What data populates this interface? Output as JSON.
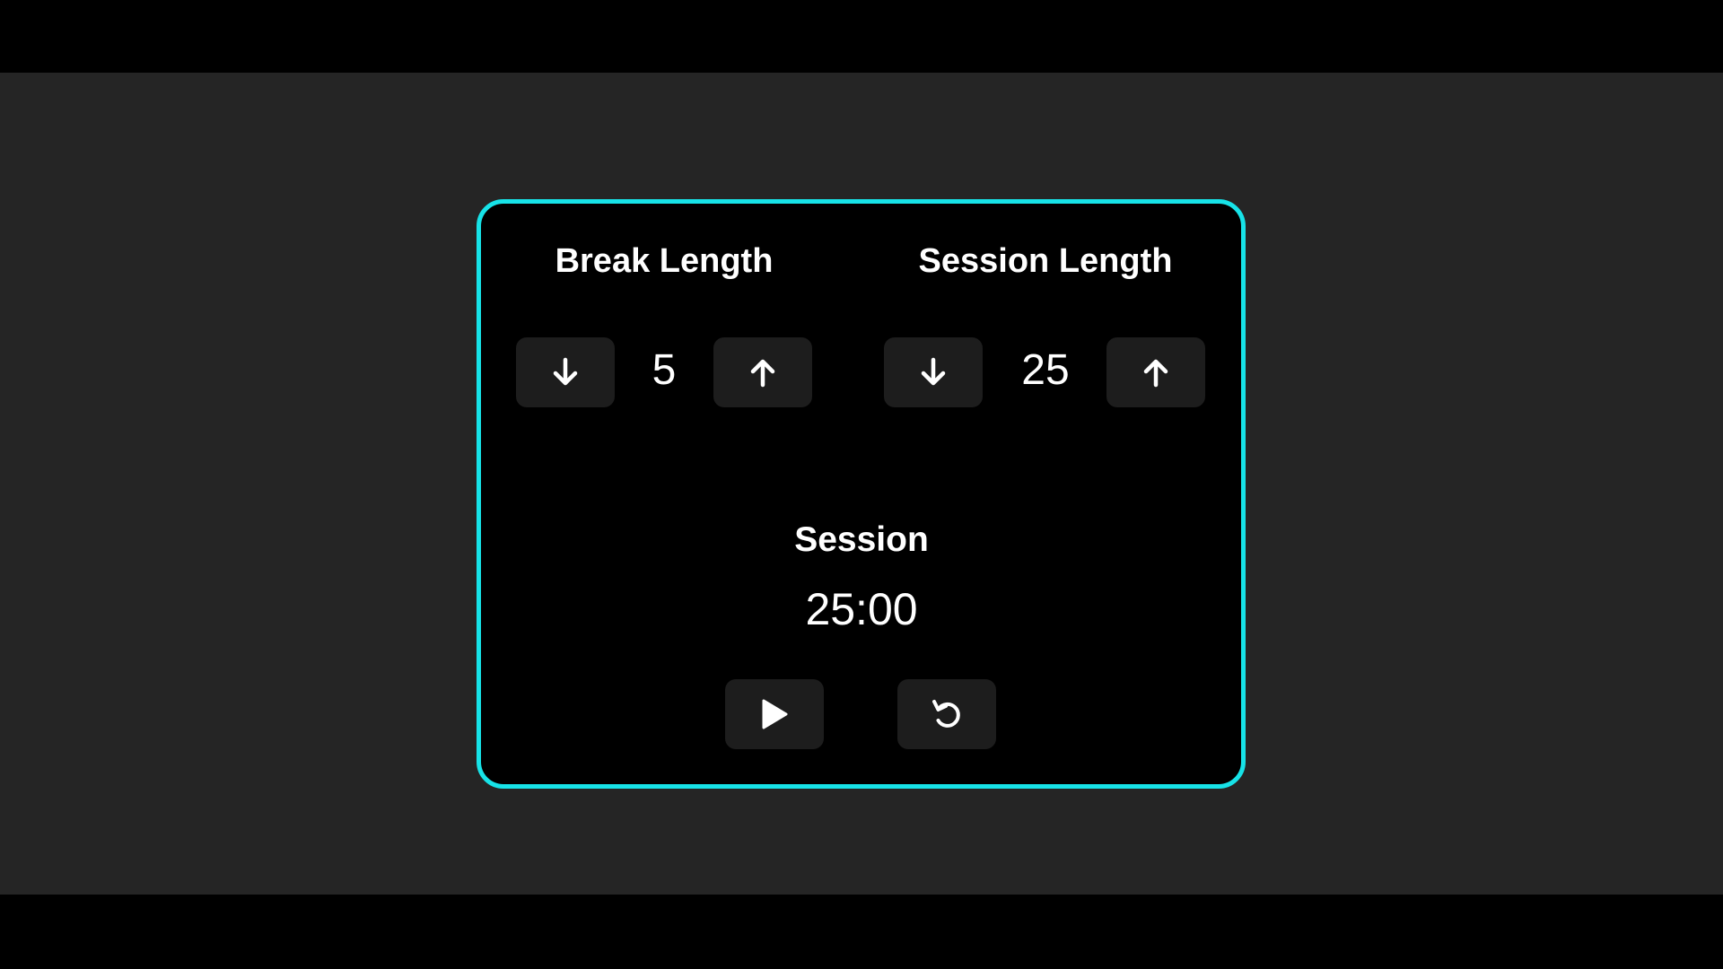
{
  "break": {
    "label": "Break Length",
    "value": "5",
    "decrement_icon": "arrow-down-icon",
    "increment_icon": "arrow-up-icon"
  },
  "session": {
    "label": "Session Length",
    "value": "25",
    "decrement_icon": "arrow-down-icon",
    "increment_icon": "arrow-up-icon"
  },
  "timer": {
    "label": "Session",
    "time_left": "25:00",
    "start_stop_icon": "play-icon",
    "reset_icon": "reset-icon"
  },
  "colors": {
    "accent_border": "#17e3e8",
    "page_background": "#252525",
    "card_background": "#000000",
    "button_background": "#1d1d1d",
    "text": "#ffffff"
  }
}
